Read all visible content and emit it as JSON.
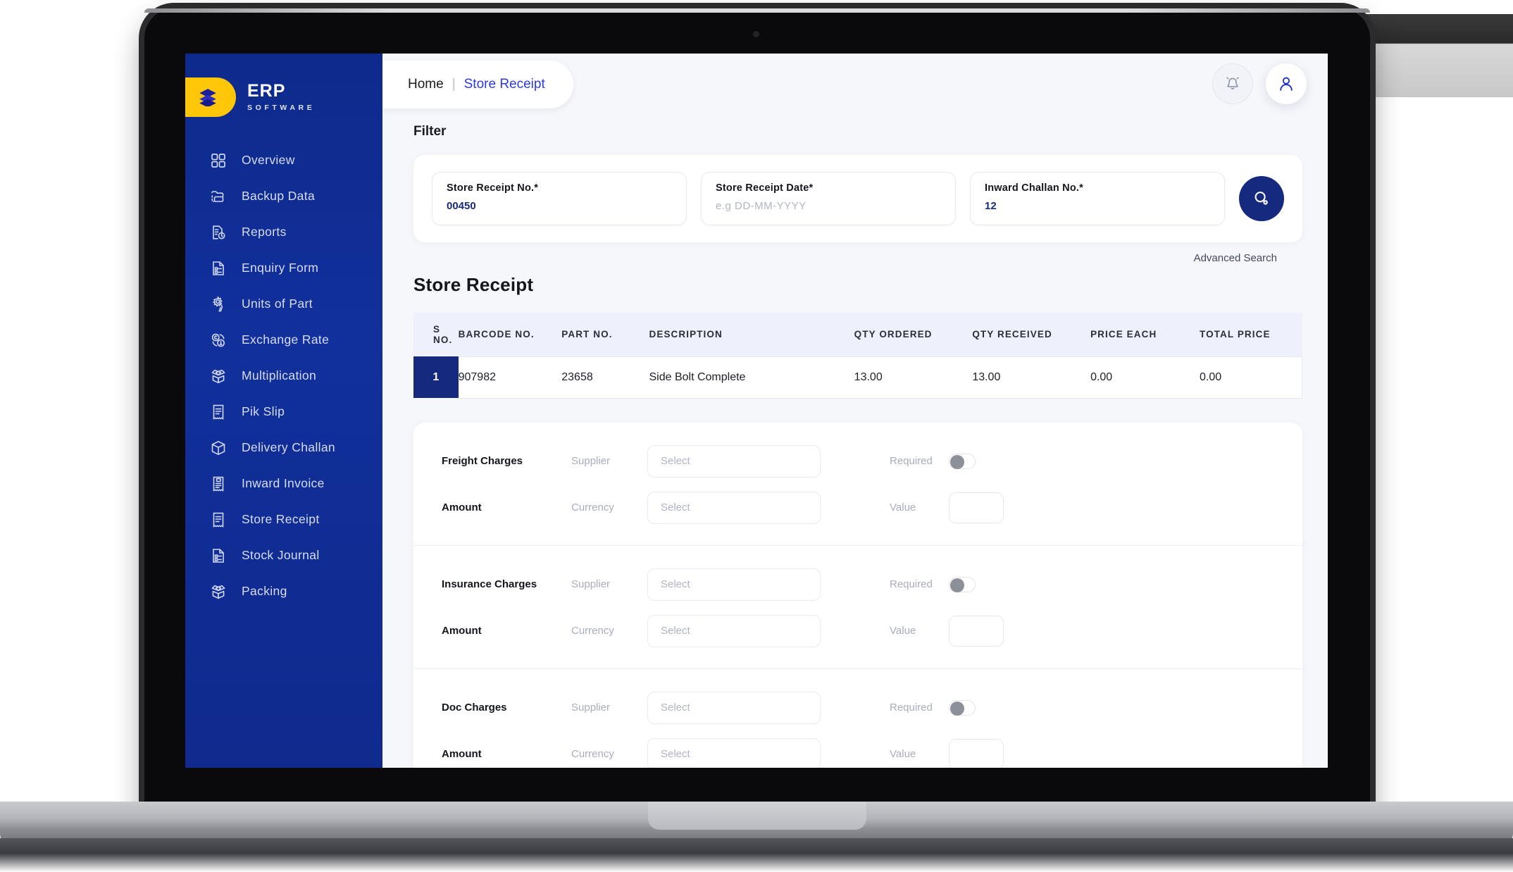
{
  "sidebar": {
    "logo": {
      "title": "ERP",
      "subtitle": "SOFTWARE",
      "icon": "layers-stack-icon"
    },
    "items": [
      {
        "label": "Overview",
        "icon": "grid-icon"
      },
      {
        "label": "Backup Data",
        "icon": "folder-backup-icon"
      },
      {
        "label": "Reports",
        "icon": "report-clock-icon"
      },
      {
        "label": "Enquiry Form",
        "icon": "document-list-icon"
      },
      {
        "label": "Units of Part",
        "icon": "gear-wrench-icon"
      },
      {
        "label": "Exchange Rate",
        "icon": "currency-exchange-icon"
      },
      {
        "label": "Multiplication",
        "icon": "open-box-icon"
      },
      {
        "label": "Pik Slip",
        "icon": "receipt-icon"
      },
      {
        "label": "Delivery Challan",
        "icon": "box-3d-icon"
      },
      {
        "label": "Inward Invoice",
        "icon": "invoice-dollar-icon"
      },
      {
        "label": "Store Receipt",
        "icon": "receipt-icon"
      },
      {
        "label": "Stock Journal",
        "icon": "document-list-icon"
      },
      {
        "label": "Packing",
        "icon": "open-box-icon"
      }
    ]
  },
  "topbar": {
    "breadcrumb": {
      "home": "Home",
      "separator": "|",
      "current": "Store Receipt"
    },
    "notification_icon": "bell-icon",
    "profile_icon": "user-avatar-icon"
  },
  "filter": {
    "title": "Filter",
    "fields": [
      {
        "label": "Store Receipt No.*",
        "value": "00450",
        "is_placeholder": false
      },
      {
        "label": "Store Receipt Date*",
        "value": "e.g DD-MM-YYYY",
        "is_placeholder": true
      },
      {
        "label": "Inward Challan No.*",
        "value": "12",
        "is_placeholder": false
      }
    ],
    "search_icon": "search-icon",
    "advanced_search": "Advanced Search"
  },
  "table": {
    "title": "Store Receipt",
    "columns": [
      "S NO.",
      "BARCODE NO.",
      "PART NO.",
      "DESCRIPTION",
      "QTY ORDERED",
      "QTY RECEIVED",
      "PRICE EACH",
      "TOTAL PRICE"
    ],
    "rows": [
      {
        "sno": "1",
        "barcode_no": "907982",
        "part_no": "23658",
        "description": "Side Bolt Complete",
        "qty_ordered": "13.00",
        "qty_received": "13.00",
        "price_each": "0.00",
        "total_price": "0.00"
      }
    ]
  },
  "charges": {
    "supplier_label": "Supplier",
    "currency_label": "Currency",
    "required_label": "Required",
    "value_label": "Value",
    "amount_label": "Amount",
    "select_placeholder": "Select",
    "blocks": [
      {
        "name": "Freight Charges"
      },
      {
        "name": "Insurance Charges"
      },
      {
        "name": "Doc Charges"
      }
    ]
  },
  "colors": {
    "sidebar_bg": "#11309b",
    "accent_yellow": "#ffc708",
    "deep_blue": "#15297e",
    "link_blue": "#2b3bdc",
    "page_bg": "#f6f7fb"
  }
}
